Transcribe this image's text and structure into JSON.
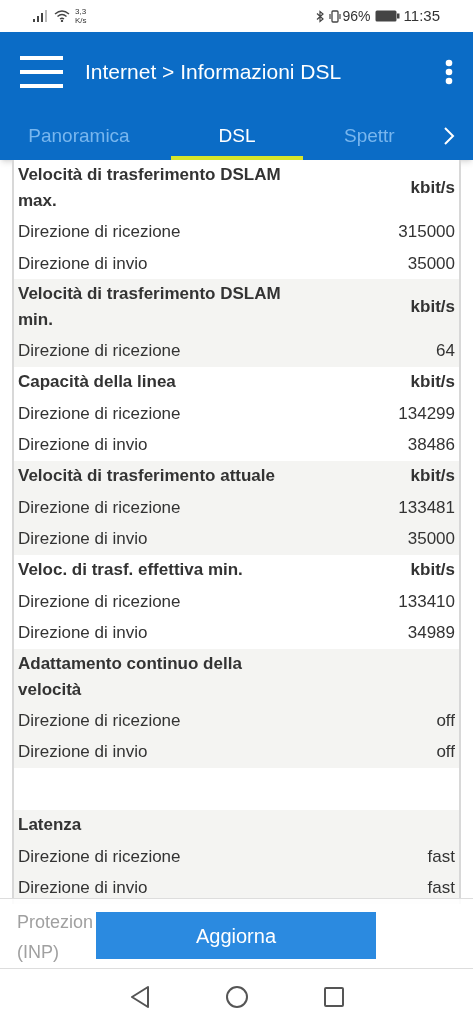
{
  "status_bar": {
    "network_speed": "3,3",
    "speed_unit": "K/s",
    "battery": "96%",
    "time": "11:35"
  },
  "app_bar": {
    "title": "Internet > Informazioni DSL"
  },
  "tabs": [
    {
      "label": "Panoramica",
      "selected": false
    },
    {
      "label": "DSL",
      "selected": true
    },
    {
      "label": "Spettr",
      "selected": false
    }
  ],
  "sections": [
    {
      "kind": "group",
      "title": "Velocità di trasferimento DSLAM max.",
      "unit": "kbit/s",
      "shaded": false,
      "rows": [
        {
          "label": "Direzione di ricezione",
          "value": "315000"
        },
        {
          "label": "Direzione di invio",
          "value": "35000"
        }
      ]
    },
    {
      "kind": "group",
      "title": "Velocità di trasferimento DSLAM min.",
      "unit": "kbit/s",
      "shaded": true,
      "rows": [
        {
          "label": "Direzione di ricezione",
          "value": "64"
        }
      ]
    },
    {
      "kind": "group",
      "title": "Capacità della linea",
      "unit": "kbit/s",
      "shaded": false,
      "rows": [
        {
          "label": "Direzione di ricezione",
          "value": "134299"
        },
        {
          "label": "Direzione di invio",
          "value": "38486"
        }
      ]
    },
    {
      "kind": "group",
      "title": "Velocità di trasferimento attuale",
      "unit": "kbit/s",
      "shaded": true,
      "rows": [
        {
          "label": "Direzione di ricezione",
          "value": "133481"
        },
        {
          "label": "Direzione di invio",
          "value": "35000"
        }
      ]
    },
    {
      "kind": "group",
      "title": "Veloc. di trasf. effettiva min.",
      "unit": "kbit/s",
      "shaded": false,
      "rows": [
        {
          "label": "Direzione di ricezione",
          "value": "133410"
        },
        {
          "label": "Direzione di invio",
          "value": "34989"
        }
      ]
    },
    {
      "kind": "group",
      "title": "Adattamento continuo della velocità",
      "shaded": true,
      "rows": [
        {
          "label": "Direzione di ricezione",
          "value": "off"
        },
        {
          "label": "Direzione di invio",
          "value": "off"
        }
      ]
    },
    {
      "kind": "spacer"
    },
    {
      "kind": "group",
      "title": "Latenza",
      "shaded": true,
      "rows": [
        {
          "label": "Direzione di ricezione",
          "value": "fast"
        },
        {
          "label": "Direzione di invio",
          "value": "fast"
        }
      ]
    }
  ],
  "footer": {
    "covered_texts": [
      "Protezion",
      "(INP)"
    ],
    "button": "Aggiorna"
  }
}
